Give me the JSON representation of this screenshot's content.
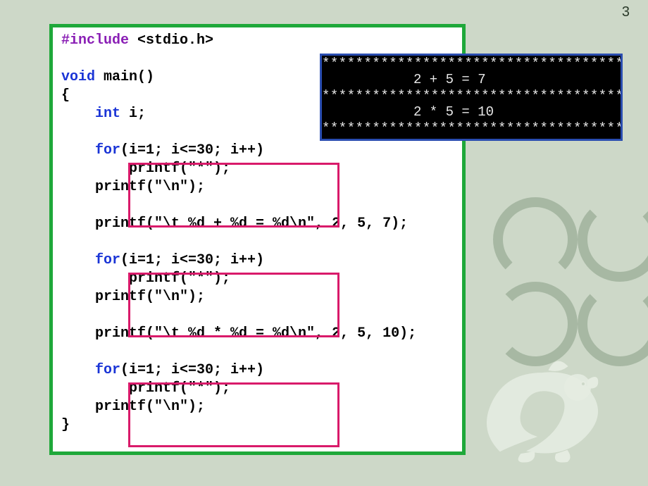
{
  "page_number": "3",
  "code": {
    "include_directive": "#include",
    "include_header": " <stdio.h>",
    "void_kw": "void",
    "main_sig": " main()",
    "open_brace": "{",
    "indent1": "    ",
    "int_kw": "int",
    "int_decl": " i;",
    "for_kw": "for",
    "for_cond": "(i=1; i<=30; i++)",
    "printf_star": "        printf(\"*\");",
    "printf_nl": "    printf(\"\\n\");",
    "printf_add": "    printf(\"\\t %d + %d = %d\\n\", 2, 5, 7);",
    "printf_mul": "    printf(\"\\t %d * %d = %d\\n\", 2, 5, 10);",
    "close_brace": "}"
  },
  "console": {
    "stars": "************************************",
    "line_add": "2 + 5 = 7",
    "line_mul": "2 * 5 = 10"
  }
}
